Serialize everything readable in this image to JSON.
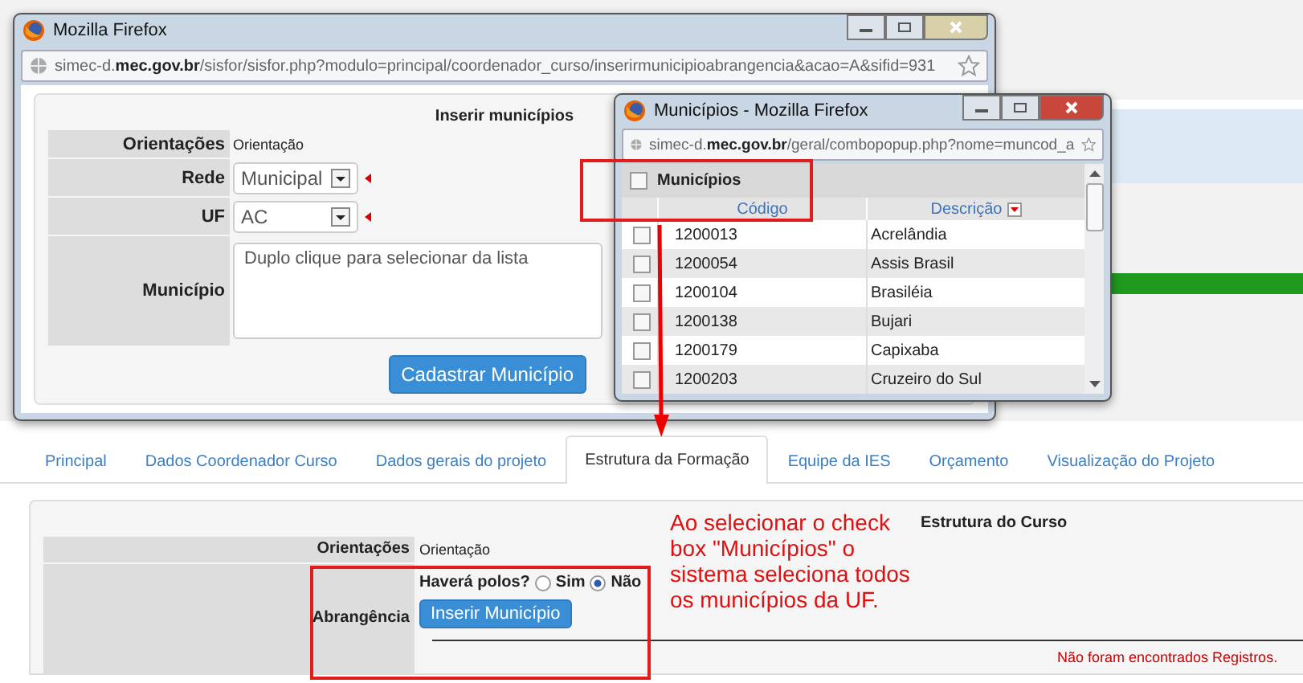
{
  "main_window": {
    "title": "Mozilla Firefox",
    "url": "simec-d.**mec.gov.br**/sisfor/sisfor.php?modulo=principal/coordenador_curso/inserirmunicipioabrangencia&acao=A&sifid=931",
    "form": {
      "title": "Inserir municípios",
      "rows": [
        {
          "kind": "text",
          "label": "Orientações",
          "value": "Orientação"
        },
        {
          "kind": "select",
          "label": "Rede",
          "value": "Municipal",
          "required": true
        },
        {
          "kind": "select",
          "label": "UF",
          "value": "AC",
          "required": true
        },
        {
          "kind": "textarea",
          "label": "Município",
          "placeholder": "Duplo clique para selecionar da lista"
        }
      ],
      "button": "Cadastrar Município"
    }
  },
  "popup_window": {
    "title": "Municípios - Mozilla Firefox",
    "url": "simec-d.**mec.gov.br**/geral/combopopup.php?nome=muncod_a",
    "table": {
      "title": "Municípios",
      "select_all_checked": false,
      "columns": [
        "Código",
        "Descrição"
      ],
      "rows": [
        {
          "code": "1200013",
          "name": "Acrelândia",
          "checked": false
        },
        {
          "code": "1200054",
          "name": "Assis Brasil",
          "checked": false
        },
        {
          "code": "1200104",
          "name": "Brasiléia",
          "checked": false
        },
        {
          "code": "1200138",
          "name": "Bujari",
          "checked": false
        },
        {
          "code": "1200179",
          "name": "Capixaba",
          "checked": false
        },
        {
          "code": "1200203",
          "name": "Cruzeiro do Sul",
          "checked": false
        }
      ]
    }
  },
  "page": {
    "tabs": [
      {
        "label": "Principal",
        "selected": false
      },
      {
        "label": "Dados Coordenador Curso",
        "selected": false
      },
      {
        "label": "Dados gerais do projeto",
        "selected": false
      },
      {
        "label": "Estrutura da Formação",
        "selected": true
      },
      {
        "label": "Equipe da IES",
        "selected": false
      },
      {
        "label": "Orçamento",
        "selected": false
      },
      {
        "label": "Visualização do Projeto",
        "selected": false
      }
    ],
    "form": {
      "title": "Estrutura do Curso",
      "orientacoes_label": "Orientações",
      "orientacoes_value": "Orientação",
      "abrangencia_label": "Abrangência",
      "question": "Haverá polos?",
      "options": [
        {
          "label": "Sim",
          "selected": false
        },
        {
          "label": "Não",
          "selected": true
        }
      ],
      "button": "Inserir Município",
      "empty_message": "Não foram encontrados Registros."
    }
  },
  "annotation": {
    "text": "Ao selecionar o check box \"Municípios\" o sistema seleciona todos os municípios da UF."
  }
}
